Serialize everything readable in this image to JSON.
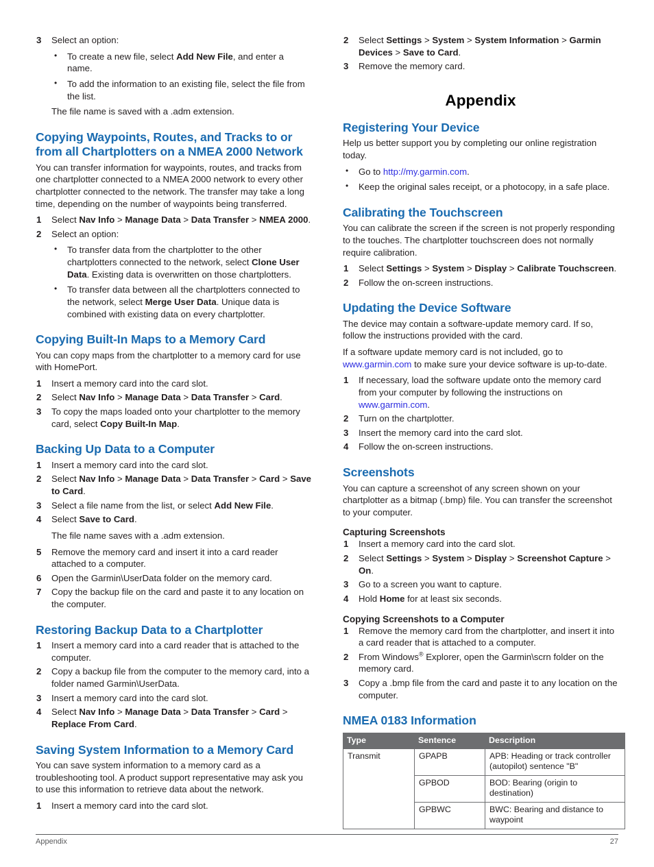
{
  "document": {
    "footer": {
      "section": "Appendix",
      "page_number": "27"
    }
  },
  "left_column": {
    "step3": {
      "num": "3",
      "text": "Select an option:",
      "bullets": [
        {
          "pre": "To create a new file, select ",
          "bold": "Add New File",
          "post": ", and enter a name."
        },
        {
          "pre": "To add the information to an existing file, select the file from the list.",
          "bold": "",
          "post": ""
        }
      ],
      "note": "The file name is saved with a .adm extension."
    },
    "section_nmea2000": {
      "heading": "Copying Waypoints, Routes, and Tracks to or from all Chartplotters on a NMEA 2000 Network",
      "intro": "You can transfer information for waypoints, routes, and tracks from one chartplotter connected to a NMEA 2000 network to every other chartplotter connected to the network. The transfer may take a long time, depending on the number of waypoints being transferred.",
      "step1_num": "1",
      "step1_a": "Select ",
      "step1_b1": "Nav Info",
      "step1_sep1": " > ",
      "step1_b2": "Manage Data",
      "step1_sep2": " > ",
      "step1_b3": "Data Transfer",
      "step1_sep3": " > ",
      "step1_b4": "NMEA 2000",
      "step1_end": ".",
      "step2_num": "2",
      "step2_text": "Select an option:",
      "bullet1_pre": "To transfer data from the chartplotter to the other chartplotters connected to the network, select ",
      "bullet1_bold": "Clone User Data",
      "bullet1_post": ". Existing data is overwritten on those chartplotters.",
      "bullet2_pre": "To transfer data between all the chartplotters connected to the network, select ",
      "bullet2_bold": "Merge User Data",
      "bullet2_post": ". Unique data is combined with existing data on every chartplotter."
    },
    "section_builtin_maps": {
      "heading": "Copying Built-In Maps to a Memory Card",
      "intro": "You can copy maps from the chartplotter to a memory card for use with HomePort.",
      "step1_num": "1",
      "step1_text": "Insert a memory card into the card slot.",
      "step2_num": "2",
      "step2_a": "Select ",
      "step2_b1": "Nav Info",
      "step2_b2": "Manage Data",
      "step2_b3": "Data Transfer",
      "step2_b4": "Card",
      "step2_end": ".",
      "step3_num": "3",
      "step3_pre": "To copy the maps loaded onto your chartplotter to the memory card, select ",
      "step3_bold": "Copy Built-In Map",
      "step3_post": "."
    },
    "section_backup": {
      "heading": "Backing Up Data to a Computer",
      "step1_num": "1",
      "step1_text": "Insert a memory card into the card slot.",
      "step2_num": "2",
      "step2_a": "Select ",
      "step2_b1": "Nav Info",
      "step2_b2": "Manage Data",
      "step2_b3": "Data Transfer",
      "step2_b4": "Card",
      "step2_b5": "Save to Card",
      "step2_end": ".",
      "step3_num": "3",
      "step3_pre": "Select a file name from the list, or select ",
      "step3_bold": "Add New File",
      "step3_post": ".",
      "step4_num": "4",
      "step4_pre": "Select ",
      "step4_bold": "Save to Card",
      "step4_post": ".",
      "step4_note": "The file name saves with a .adm extension.",
      "step5_num": "5",
      "step5_text": "Remove the memory card and insert it into a card reader attached to a computer.",
      "step6_num": "6",
      "step6_text": "Open the Garmin\\UserData folder on the memory card.",
      "step7_num": "7",
      "step7_text": "Copy the backup file on the card and paste it to any location on the computer."
    },
    "section_restore": {
      "heading": "Restoring Backup Data to a Chartplotter",
      "step1_num": "1",
      "step1_text": "Insert a memory card into a card reader that is attached to the computer.",
      "step2_num": "2",
      "step2_text": "Copy a backup file from the computer to the memory card, into a folder named Garmin\\UserData.",
      "step3_num": "3",
      "step3_text": "Insert a memory card into the card slot.",
      "step4_num": "4",
      "step4_a": "Select ",
      "step4_b1": "Nav Info",
      "step4_b2": "Manage Data",
      "step4_b3": "Data Transfer",
      "step4_b4": "Card",
      "step4_b5": "Replace From Card",
      "step4_end": "."
    },
    "section_sysinfo": {
      "heading": "Saving System Information to a Memory Card",
      "intro": "You can save system information to a memory card as a troubleshooting tool. A product support representative may ask you to use this information to retrieve data about the network.",
      "step1_num": "1",
      "step1_text": "Insert a memory card into the card slot."
    }
  },
  "right_column": {
    "sysinfo_cont": {
      "step2_num": "2",
      "step2_a": "Select ",
      "step2_b1": "Settings",
      "step2_b2": "System",
      "step2_b3": "System Information",
      "step2_b4": "Garmin Devices",
      "step2_b5": "Save to Card",
      "step2_end": ".",
      "step3_num": "3",
      "step3_text": "Remove the memory card."
    },
    "appendix_title": "Appendix",
    "section_register": {
      "heading": "Registering Your Device",
      "intro": "Help us better support you by completing our online registration today.",
      "bullet1_pre": "Go to ",
      "bullet1_link": "http://my.garmin.com",
      "bullet1_post": ".",
      "bullet2": "Keep the original sales receipt, or a photocopy, in a safe place."
    },
    "section_calibrate": {
      "heading": "Calibrating the Touchscreen",
      "intro": "You can calibrate the screen if the screen is not properly responding to the touches. The chartplotter touchscreen does not normally require calibration.",
      "step1_num": "1",
      "step1_a": "Select ",
      "step1_b1": "Settings",
      "step1_b2": "System",
      "step1_b3": "Display",
      "step1_b4": "Calibrate Touchscreen",
      "step1_end": ".",
      "step2_num": "2",
      "step2_text": "Follow the on-screen instructions."
    },
    "section_update": {
      "heading": "Updating the Device Software",
      "para1": "The device may contain a software-update memory card. If so, follow the instructions provided with the card.",
      "para2_pre": "If a software update memory card is not included, go to ",
      "para2_link": "www.garmin.com",
      "para2_post": " to make sure your device software is up-to-date.",
      "step1_num": "1",
      "step1_pre": "If necessary, load the software update onto the memory card from your computer by following the instructions on ",
      "step1_link": "www.garmin.com",
      "step1_post": ".",
      "step2_num": "2",
      "step2_text": "Turn on the chartplotter.",
      "step3_num": "3",
      "step3_text": "Insert the memory card into the card slot.",
      "step4_num": "4",
      "step4_text": "Follow the on-screen instructions."
    },
    "section_screenshots": {
      "heading": "Screenshots",
      "intro": "You can capture a screenshot of any screen shown on your chartplotter as a bitmap (.bmp) file. You can transfer the screenshot to your computer.",
      "sub_capturing": {
        "heading": "Capturing Screenshots",
        "step1_num": "1",
        "step1_text": "Insert a memory card into the card slot.",
        "step2_num": "2",
        "step2_a": "Select ",
        "step2_b1": "Settings",
        "step2_b2": "System",
        "step2_b3": "Display",
        "step2_b4": "Screenshot Capture",
        "step2_b5": "On",
        "step2_end": ".",
        "step3_num": "3",
        "step3_text": "Go to a screen you want to capture.",
        "step4_num": "4",
        "step4_pre": "Hold ",
        "step4_bold": "Home",
        "step4_post": " for at least six seconds."
      },
      "sub_copying": {
        "heading": "Copying Screenshots to a Computer",
        "step1_num": "1",
        "step1_text": "Remove the memory card from the chartplotter, and insert it into a card reader that is attached to a computer.",
        "step2_num": "2",
        "step2_pre": "From Windows",
        "step2_sup": "®",
        "step2_post": " Explorer, open the Garmin\\scrn folder on the memory card.",
        "step3_num": "3",
        "step3_text": "Copy a .bmp file from the card and paste it to any location on the computer."
      }
    },
    "section_nmea0183": {
      "heading": "NMEA 0183 Information",
      "table": {
        "headers": [
          "Type",
          "Sentence",
          "Description"
        ],
        "rows": [
          {
            "type": "Transmit",
            "sentence": "GPAPB",
            "description": "APB: Heading or track controller (autopilot) sentence \"B\""
          },
          {
            "type": "",
            "sentence": "GPBOD",
            "description": "BOD: Bearing (origin to destination)"
          },
          {
            "type": "",
            "sentence": "GPBWC",
            "description": "BWC: Bearing and distance to waypoint"
          }
        ]
      }
    }
  },
  "colors": {
    "heading_blue": "#1a6bb0",
    "link_blue": "#2d2de0",
    "table_header_gray": "#6d6e70",
    "body_text": "#231f20",
    "footer_gray": "#58595b"
  }
}
